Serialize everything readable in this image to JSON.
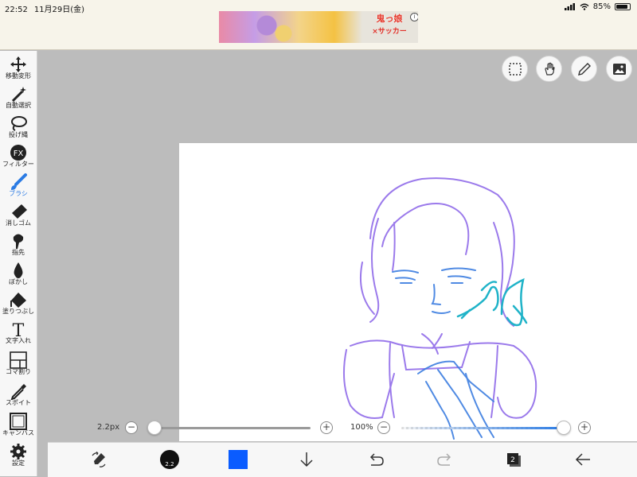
{
  "status_bar": {
    "time": "22:52",
    "date": "11月29日(金)",
    "battery": "85%",
    "battery_level": 0.85
  },
  "ad": {
    "line1": "鬼っ娘",
    "line2": "×サッカー",
    "info": "i"
  },
  "tools": [
    {
      "id": "move",
      "label": "移動変形",
      "icon": "move-arrows-icon"
    },
    {
      "id": "auto-select",
      "label": "自動選択",
      "icon": "magic-wand-icon"
    },
    {
      "id": "lasso",
      "label": "投げ縄",
      "icon": "lasso-icon"
    },
    {
      "id": "filter",
      "label": "フィルター",
      "icon": "fx-icon",
      "icon_text": "FX"
    },
    {
      "id": "brush",
      "label": "ブラシ",
      "icon": "brush-icon",
      "active": true
    },
    {
      "id": "eraser",
      "label": "消しゴム",
      "icon": "eraser-icon"
    },
    {
      "id": "finger",
      "label": "指先",
      "icon": "finger-icon"
    },
    {
      "id": "blur",
      "label": "ぼかし",
      "icon": "drop-icon"
    },
    {
      "id": "fill",
      "label": "塗りつぶし",
      "icon": "bucket-icon"
    },
    {
      "id": "text",
      "label": "文字入れ",
      "icon": "text-icon",
      "icon_text": "T"
    },
    {
      "id": "frame",
      "label": "コマ割り",
      "icon": "panel-icon"
    },
    {
      "id": "eyedropper",
      "label": "スポイト",
      "icon": "eyedropper-icon"
    },
    {
      "id": "canvas",
      "label": "キャンバス",
      "icon": "canvas-icon"
    },
    {
      "id": "settings",
      "label": "設定",
      "icon": "gear-icon"
    }
  ],
  "top_buttons": [
    "selection-icon",
    "hand-icon",
    "pen-icon",
    "image-icon"
  ],
  "brush_size": {
    "label": "2.2px",
    "value_fraction": 0.0,
    "minus": "−",
    "plus": "+"
  },
  "opacity": {
    "label": "100%",
    "value_fraction": 1.0,
    "minus": "−",
    "plus": "+"
  },
  "bottom_bar": {
    "brush_size_text": "2.2",
    "color": "#0a5cff",
    "layer_count": "2",
    "icons": [
      "brush-swap-icon",
      "brush-size-icon",
      "color-swatch-icon",
      "download-icon",
      "undo-icon",
      "redo-icon",
      "layers-icon",
      "back-icon"
    ]
  },
  "colors": {
    "accent": "#2b7be4",
    "sketch_purple": "#8a63e8",
    "sketch_blue": "#3d7ee0",
    "sketch_cyan": "#1fb3c8"
  }
}
